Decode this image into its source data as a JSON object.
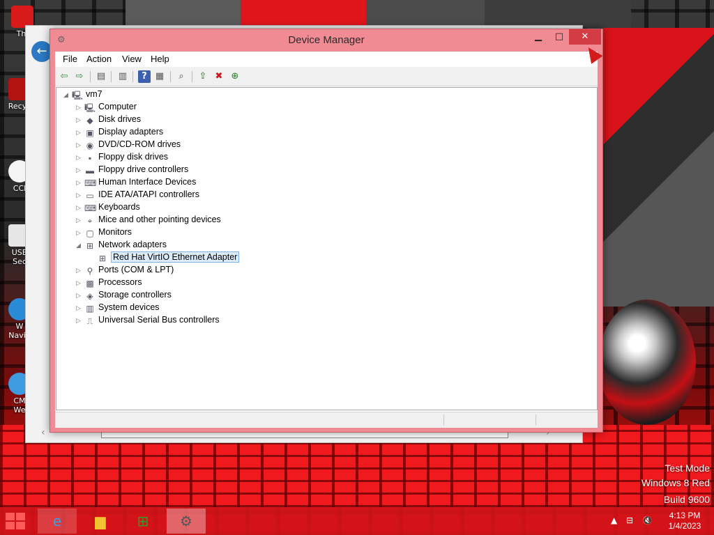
{
  "desktop": {
    "icons": [
      {
        "label": "Thi",
        "icon": "recovery-icon"
      },
      {
        "label": "Recyc",
        "icon": "recycle-bin-icon"
      },
      {
        "label": "CCl",
        "icon": "ccleaner-icon"
      },
      {
        "label": "USB\nSec",
        "icon": "usb-security-icon"
      },
      {
        "label": "W\nNavig",
        "icon": "navigator-icon"
      },
      {
        "label": "CM\nWe",
        "icon": "browser-icon"
      }
    ],
    "watermark": [
      "Test Mode",
      "Windows 8 Red",
      "Build 9600"
    ]
  },
  "window": {
    "title": "Device Manager",
    "buttons": {
      "minimize": "▁",
      "maximize": "□",
      "close": "✕"
    }
  },
  "menu": [
    "File",
    "Action",
    "View",
    "Help"
  ],
  "toolbar": {
    "back": "⇦",
    "forward": "⇨",
    "t3": "▤",
    "t4": "▥",
    "help": "?",
    "t6": "▦",
    "scan": "⌕",
    "update": "⇪",
    "uninstall": "✖",
    "enable": "⊕"
  },
  "tree": {
    "root": "vm7",
    "categories": [
      {
        "label": "Computer",
        "expanded": false,
        "icon": "🖳"
      },
      {
        "label": "Disk drives",
        "expanded": false,
        "icon": "◆"
      },
      {
        "label": "Display adapters",
        "expanded": false,
        "icon": "▣"
      },
      {
        "label": "DVD/CD-ROM drives",
        "expanded": false,
        "icon": "◉"
      },
      {
        "label": "Floppy disk drives",
        "expanded": false,
        "icon": "▪"
      },
      {
        "label": "Floppy drive controllers",
        "expanded": false,
        "icon": "▬"
      },
      {
        "label": "Human Interface Devices",
        "expanded": false,
        "icon": "⌨"
      },
      {
        "label": "IDE ATA/ATAPI controllers",
        "expanded": false,
        "icon": "▭"
      },
      {
        "label": "Keyboards",
        "expanded": false,
        "icon": "⌨"
      },
      {
        "label": "Mice and other pointing devices",
        "expanded": false,
        "icon": "⌖"
      },
      {
        "label": "Monitors",
        "expanded": false,
        "icon": "▢"
      },
      {
        "label": "Network adapters",
        "expanded": true,
        "icon": "⊞",
        "children": [
          {
            "label": "Red Hat VirtIO Ethernet Adapter",
            "selected": true,
            "icon": "⊞"
          }
        ]
      },
      {
        "label": "Ports (COM & LPT)",
        "expanded": false,
        "icon": "⚲"
      },
      {
        "label": "Processors",
        "expanded": false,
        "icon": "▩"
      },
      {
        "label": "Storage controllers",
        "expanded": false,
        "icon": "◈"
      },
      {
        "label": "System devices",
        "expanded": false,
        "icon": "▥"
      },
      {
        "label": "Universal Serial Bus controllers",
        "expanded": false,
        "icon": "⎍"
      }
    ]
  },
  "taskbar": {
    "apps": [
      {
        "name": "Internet Explorer",
        "icon": "e"
      },
      {
        "name": "File Explorer",
        "icon": "▆"
      },
      {
        "name": "Store",
        "icon": "⊞"
      },
      {
        "name": "Device Manager",
        "icon": "⚙"
      }
    ],
    "tray": {
      "up": "▲",
      "network": "⊟",
      "volume": "🔇"
    },
    "time": "4:13 PM",
    "date": "1/4/2023"
  },
  "colors": {
    "accent": "#d31b1b",
    "window_frame": "#f08b94",
    "selection": "#dcecfc"
  }
}
